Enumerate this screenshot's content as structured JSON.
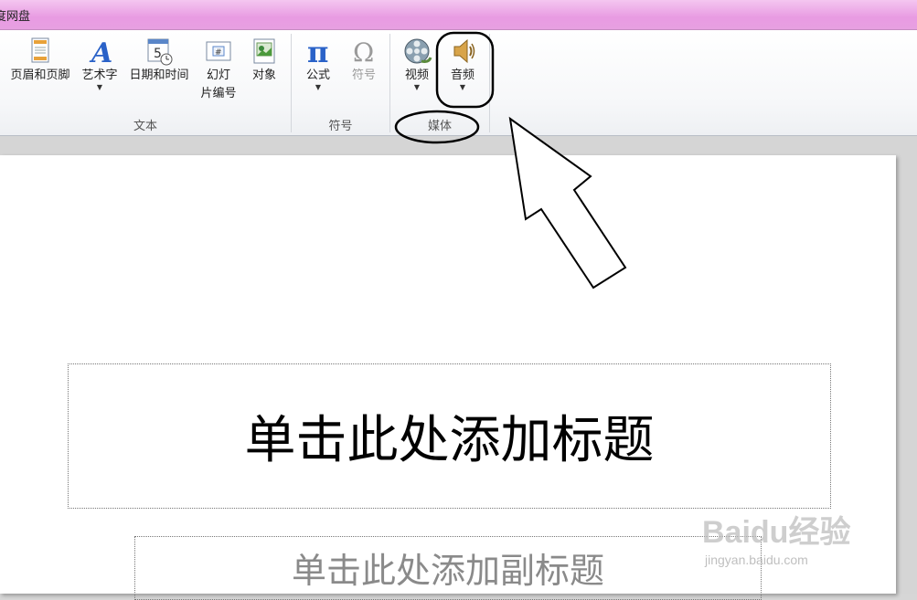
{
  "window": {
    "title": "度网盘"
  },
  "ribbon": {
    "text_group": {
      "label": "文本",
      "buttons": [
        {
          "label": "页眉和页脚",
          "icon": "header-footer-icon"
        },
        {
          "label": "艺术字",
          "icon": "wordart-icon",
          "has_dropdown": true
        },
        {
          "label": "日期和时间",
          "icon": "date-time-icon"
        },
        {
          "label_line1": "幻灯",
          "label_line2": "片编号",
          "icon": "slide-number-icon"
        },
        {
          "label": "对象",
          "icon": "object-icon"
        }
      ]
    },
    "symbol_group": {
      "label": "符号",
      "buttons": [
        {
          "label": "公式",
          "icon": "equation-icon",
          "has_dropdown": true
        },
        {
          "label": "符号",
          "icon": "omega-icon",
          "disabled": true
        }
      ]
    },
    "media_group": {
      "label": "媒体",
      "buttons": [
        {
          "label": "视频",
          "icon": "video-film-icon",
          "has_dropdown": true
        },
        {
          "label": "音频",
          "icon": "speaker-icon",
          "has_dropdown": true
        }
      ]
    }
  },
  "slide": {
    "title_placeholder": "单击此处添加标题",
    "subtitle_placeholder": "单击此处添加副标题"
  },
  "watermark": {
    "logo": "Baidu经验",
    "url": "jingyan.baidu.com"
  },
  "colors": {
    "titlebar": "#e89be2",
    "annotation": "#000000"
  }
}
